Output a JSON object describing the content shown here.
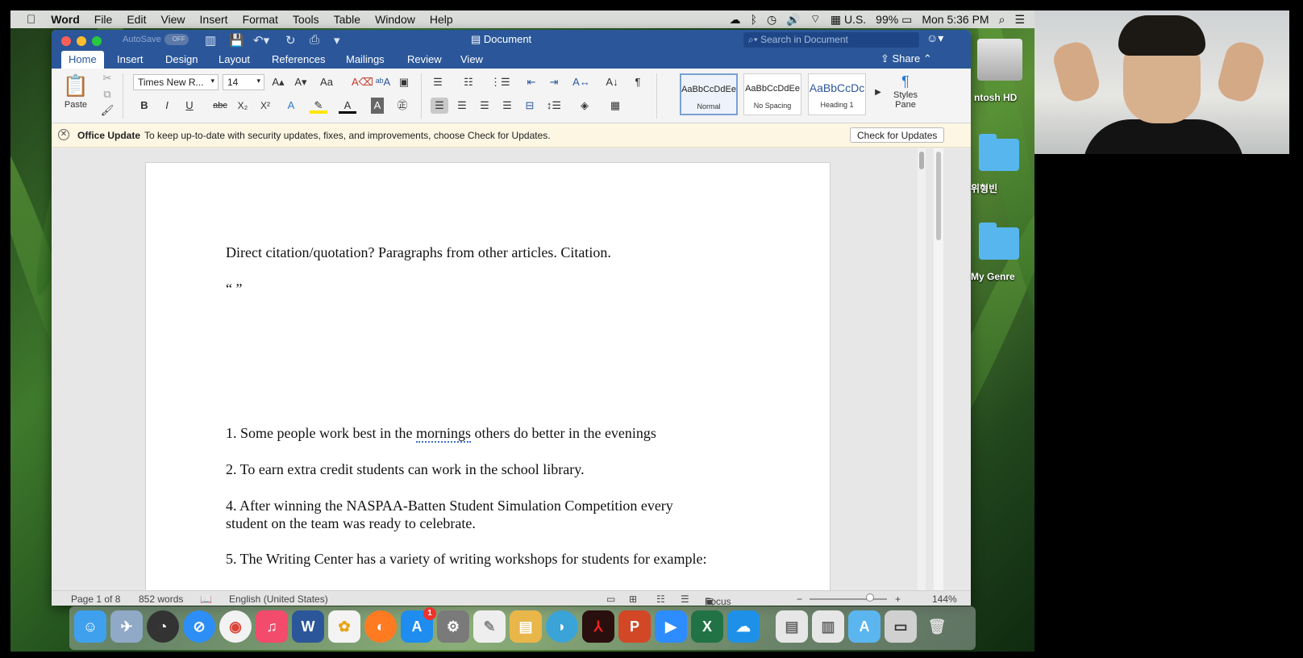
{
  "menubar": {
    "app": "Word",
    "items": [
      "File",
      "Edit",
      "View",
      "Insert",
      "Format",
      "Tools",
      "Table",
      "Window",
      "Help"
    ],
    "input_source": "U.S.",
    "battery": "99%",
    "clock": "Mon 5:36 PM"
  },
  "window": {
    "autosave_label": "AutoSave",
    "autosave_state": "OFF",
    "title": "Document",
    "search_placeholder": "Search in Document",
    "tabs": [
      "Home",
      "Insert",
      "Design",
      "Layout",
      "References",
      "Mailings",
      "Review",
      "View"
    ],
    "share_label": "Share"
  },
  "ribbon": {
    "paste_label": "Paste",
    "font_name": "Times New R...",
    "font_size": "14",
    "styles": [
      {
        "preview": "AaBbCcDdEe",
        "name": "Normal"
      },
      {
        "preview": "AaBbCcDdEe",
        "name": "No Spacing"
      },
      {
        "preview": "AaBbCcDc",
        "name": "Heading 1"
      }
    ],
    "styles_pane_label": "Styles Pane"
  },
  "banner": {
    "title": "Office Update",
    "message": "To keep up-to-date with security updates, fixes, and improvements, choose Check for Updates.",
    "button": "Check for Updates"
  },
  "document": {
    "line1": "Direct citation/quotation? Paragraphs from other articles. Citation.",
    "line2": "“ ”",
    "item1_pre": "1. Some people work best in the ",
    "item1_err": "mornings",
    "item1_post": " others do better in the evenings",
    "item2": "2. To earn extra credit students can work in the school library.",
    "item4a": "4. After winning the NASPAA-Batten Student Simulation Competition every",
    "item4b": "student on the team was ready to celebrate.",
    "item5": "5. The Writing Center has a variety of writing workshops for students for example:"
  },
  "status": {
    "page": "Page 1 of 8",
    "words": "852 words",
    "language": "English (United States)",
    "focus": "Focus",
    "zoom": "144%",
    "zoom_level": 0.78
  },
  "desktop_icons": [
    "ntosh HD",
    "위형빈",
    "My Genre"
  ],
  "dock": {
    "appstore_badge": "1"
  }
}
